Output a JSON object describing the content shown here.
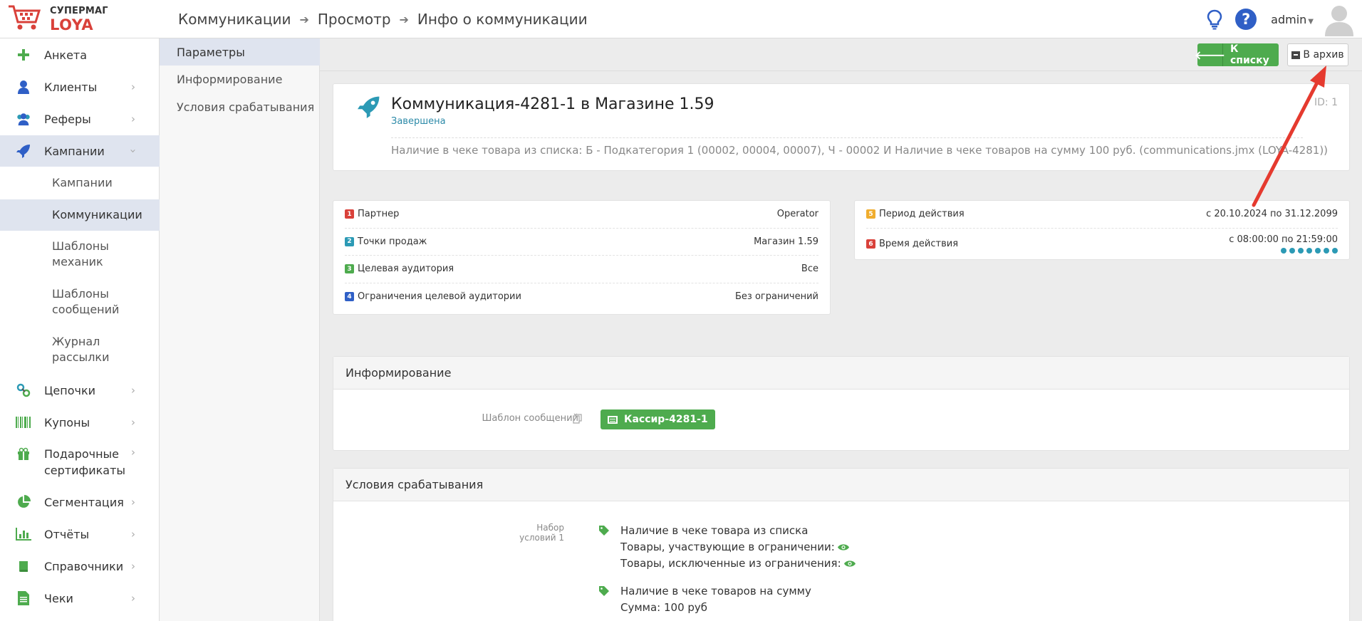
{
  "app": {
    "brand_line1": "СУПЕРМАГ",
    "brand_line2": "LOYA",
    "user": "admin"
  },
  "breadcrumbs": [
    "Коммуникации",
    "Просмотр",
    "Инфо о коммуникации"
  ],
  "sidebar": {
    "items": [
      {
        "label": "Анкета",
        "icon": "plus-icon"
      },
      {
        "label": "Клиенты",
        "icon": "user-icon"
      },
      {
        "label": "Реферы",
        "icon": "users-icon"
      },
      {
        "label": "Кампании",
        "icon": "rocket-icon"
      },
      {
        "label": "Цепочки",
        "icon": "link-icon"
      },
      {
        "label": "Купоны",
        "icon": "barcode-icon"
      },
      {
        "label": "Подарочные сертификаты",
        "icon": "gift-icon"
      },
      {
        "label": "Сегментация",
        "icon": "pie-chart-icon"
      },
      {
        "label": "Отчёты",
        "icon": "bar-chart-icon"
      },
      {
        "label": "Справочники",
        "icon": "book-icon"
      },
      {
        "label": "Чеки",
        "icon": "receipt-icon"
      }
    ],
    "sub": [
      {
        "label": "Кампании"
      },
      {
        "label": "Коммуникации"
      },
      {
        "label": "Шаблоны механик"
      },
      {
        "label": "Шаблоны сообщений"
      },
      {
        "label": "Журнал рассылки"
      }
    ]
  },
  "subnav": [
    "Параметры",
    "Информирование",
    "Условия срабатывания"
  ],
  "toolbar": {
    "list": "К списку",
    "archive": "В архив"
  },
  "header": {
    "title": "Коммуникация-4281-1 в Магазине 1.59",
    "status": "Завершена",
    "id": "ID: 1",
    "description": "Наличие в чеке товара из списка: Б - Подкатегория 1 (00002, 00004, 00007), Ч - 00002 И Наличие в чеке товаров на сумму 100 руб. (communications.jmx (LOYA-4281))"
  },
  "params_left": [
    {
      "n": "1",
      "label": "Партнер",
      "value": "Operator",
      "color": "#d9413a"
    },
    {
      "n": "2",
      "label": "Точки продаж",
      "value": "Магазин 1.59",
      "color": "#2c9ab5"
    },
    {
      "n": "3",
      "label": "Целевая аудитория",
      "value": "Все",
      "color": "#4eab4e"
    },
    {
      "n": "4",
      "label": "Ограничения целевой аудитории",
      "value": "Без ограничений",
      "color": "#2f5fc6"
    }
  ],
  "params_right": [
    {
      "n": "5",
      "label": "Период действия",
      "value": "с 20.10.2024 по 31.12.2099",
      "color": "#f0ad2e"
    },
    {
      "n": "6",
      "label": "Время действия",
      "value": "с 08:00:00 по 21:59:00",
      "color": "#d9413a"
    }
  ],
  "info": {
    "title": "Информирование",
    "template_label": "Шаблон сообщений",
    "template_value": "Кассир-4281-1"
  },
  "conditions": {
    "title": "Условия срабатывания",
    "set_label": "Набор условий 1",
    "c1": "Наличие в чеке товара из списка",
    "c1_l1": "Товары, участвующие в ограничении:",
    "c1_l2": "Товары, исключенные из ограничения:",
    "c2": "Наличие в чеке товаров на сумму",
    "c2_l1": "Сумма: 100 руб"
  }
}
